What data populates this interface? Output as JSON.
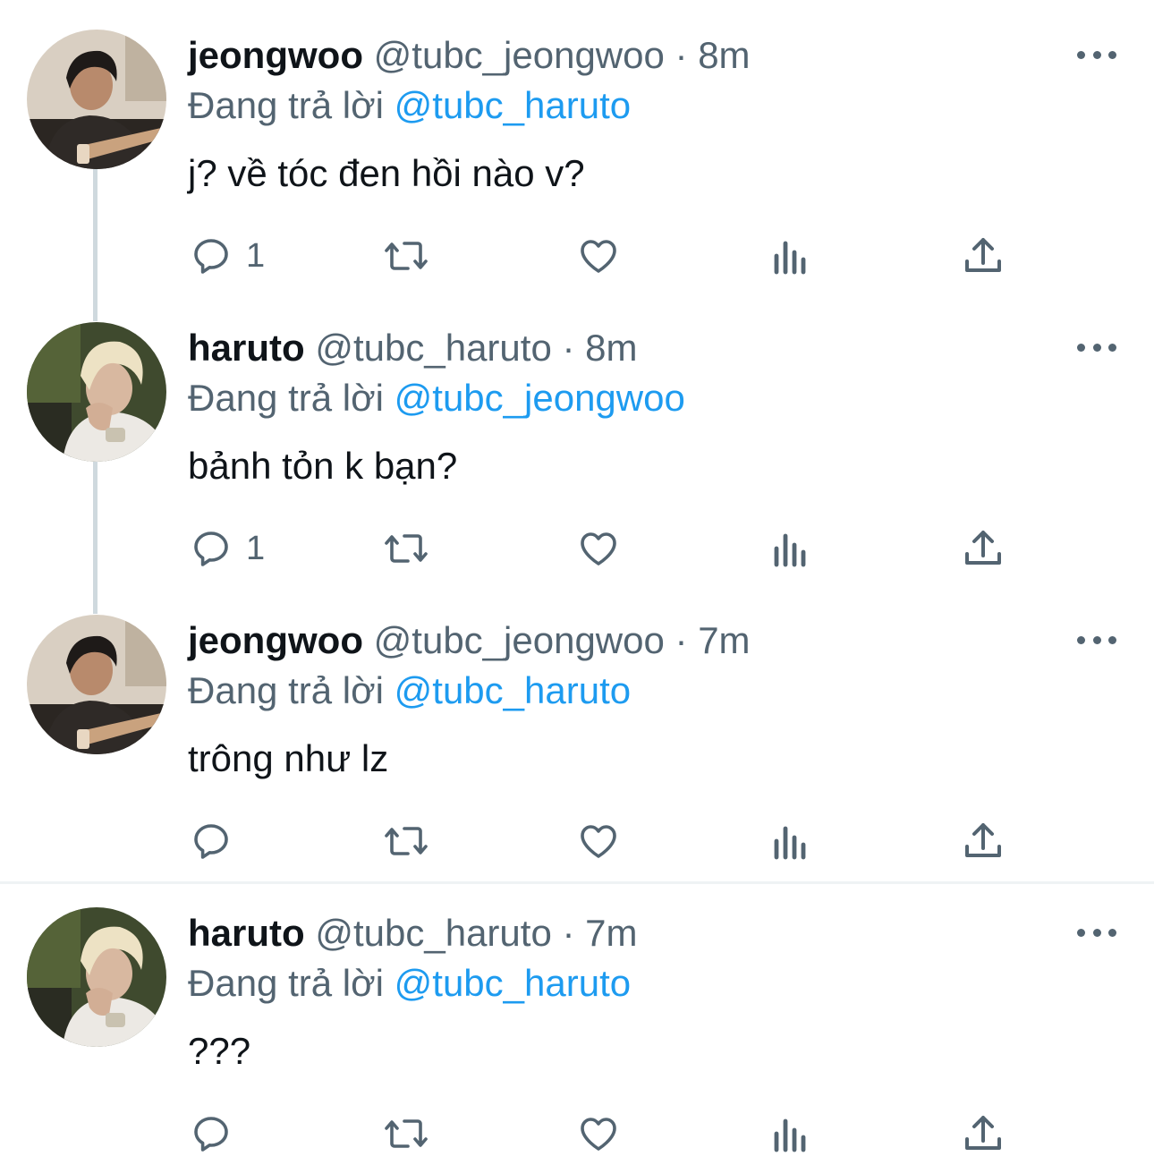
{
  "colors": {
    "name": "#0f1419",
    "secondary": "#536471",
    "mention": "#1d9bf0",
    "thread_line": "#cfd9de",
    "divider": "#eff3f4"
  },
  "tweets": [
    {
      "avatar_icon": "user-avatar-jeongwoo",
      "name": "jeongwoo",
      "handle": "@tubc_jeongwoo",
      "separator": "·",
      "time": "8m",
      "reply_prefix": "Đang trả lời",
      "reply_to": "@tubc_haruto",
      "text": "j? về tóc đen hồi nào v?",
      "reply_count": "1"
    },
    {
      "avatar_icon": "user-avatar-haruto",
      "name": "haruto",
      "handle": "@tubc_haruto",
      "separator": "·",
      "time": "8m",
      "reply_prefix": "Đang trả lời",
      "reply_to": "@tubc_jeongwoo",
      "text": "bảnh tỏn k bạn?",
      "reply_count": "1"
    },
    {
      "avatar_icon": "user-avatar-jeongwoo",
      "name": "jeongwoo",
      "handle": "@tubc_jeongwoo",
      "separator": "·",
      "time": "7m",
      "reply_prefix": "Đang trả lời",
      "reply_to": "@tubc_haruto",
      "text": "trông như lz",
      "reply_count": ""
    },
    {
      "avatar_icon": "user-avatar-haruto",
      "name": "haruto",
      "handle": "@tubc_haruto",
      "separator": "·",
      "time": "7m",
      "reply_prefix": "Đang trả lời",
      "reply_to": "@tubc_haruto",
      "text": "???",
      "reply_count": ""
    }
  ],
  "icons": {
    "reply": "reply-icon",
    "retweet": "retweet-icon",
    "like": "heart-icon",
    "analytics": "analytics-icon",
    "share": "share-icon",
    "more": "more-icon"
  }
}
